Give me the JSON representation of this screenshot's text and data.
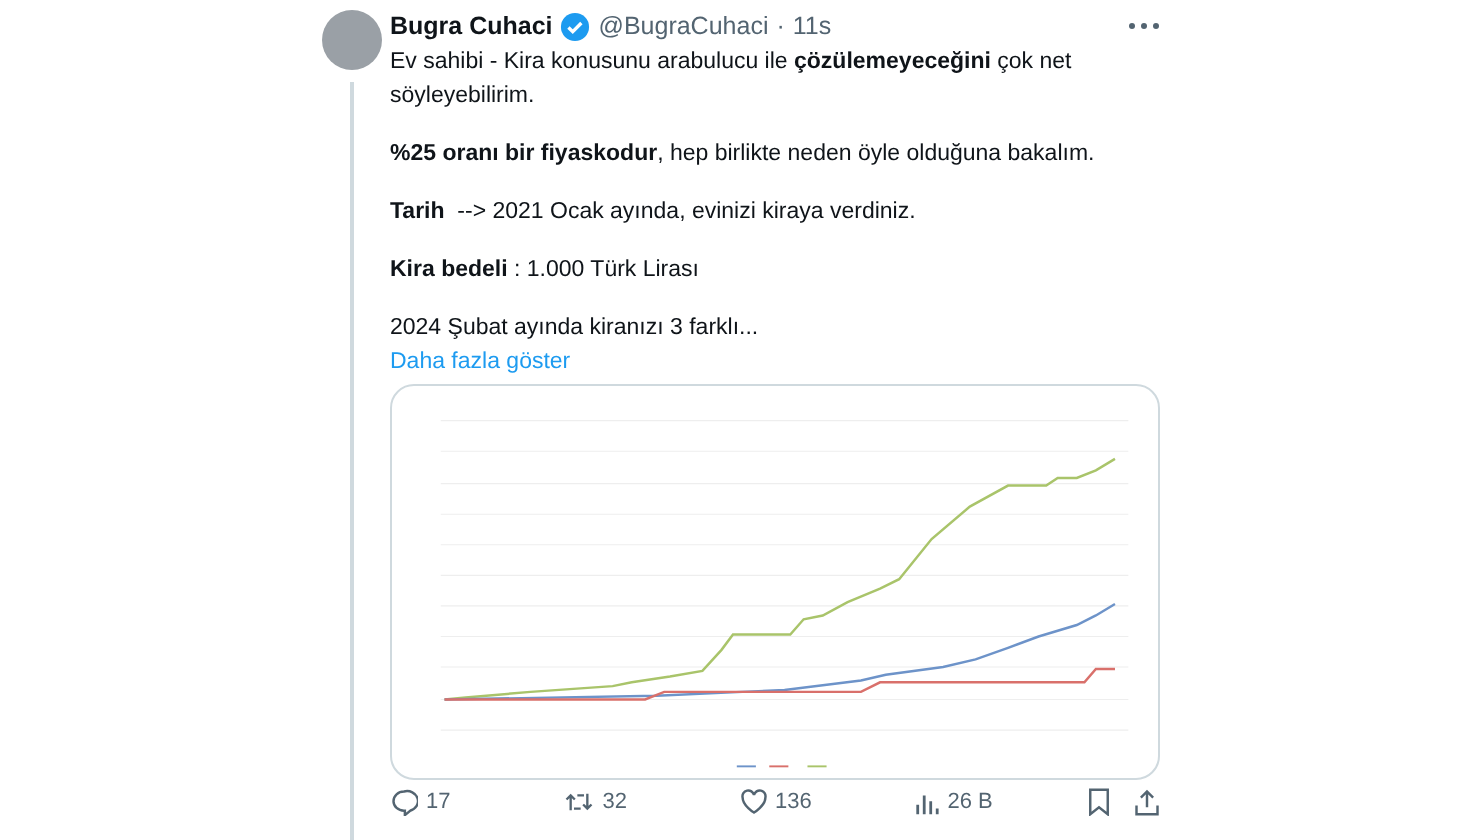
{
  "tweet": {
    "author": {
      "name": "Bugra Cuhaci",
      "handle": "@BugraCuhaci",
      "separator": "·",
      "time": "11s",
      "verified": true
    },
    "paragraphs": [
      "Ev sahibi - Kira konusunu arabulucu ile **çözülemeyeceğini** çok net söyleyebilirim.",
      "**%25 oranı bir fiyaskodur**, hep birlikte neden öyle olduğuna bakalım.",
      "**Tarih**  --> 2021 Ocak ayında, evinizi kiraya verdiniz.",
      "**Kira bedeli** : 1.000 Türk Lirası",
      "2024 Şubat ayında kiranızı 3 farklı..."
    ],
    "show_more": "Daha fazla göster",
    "actions": [
      {
        "kind": "reply",
        "count": "17"
      },
      {
        "kind": "repost",
        "count": "32"
      },
      {
        "kind": "like",
        "count": "136"
      },
      {
        "kind": "views",
        "count": "26 B"
      }
    ]
  }
}
